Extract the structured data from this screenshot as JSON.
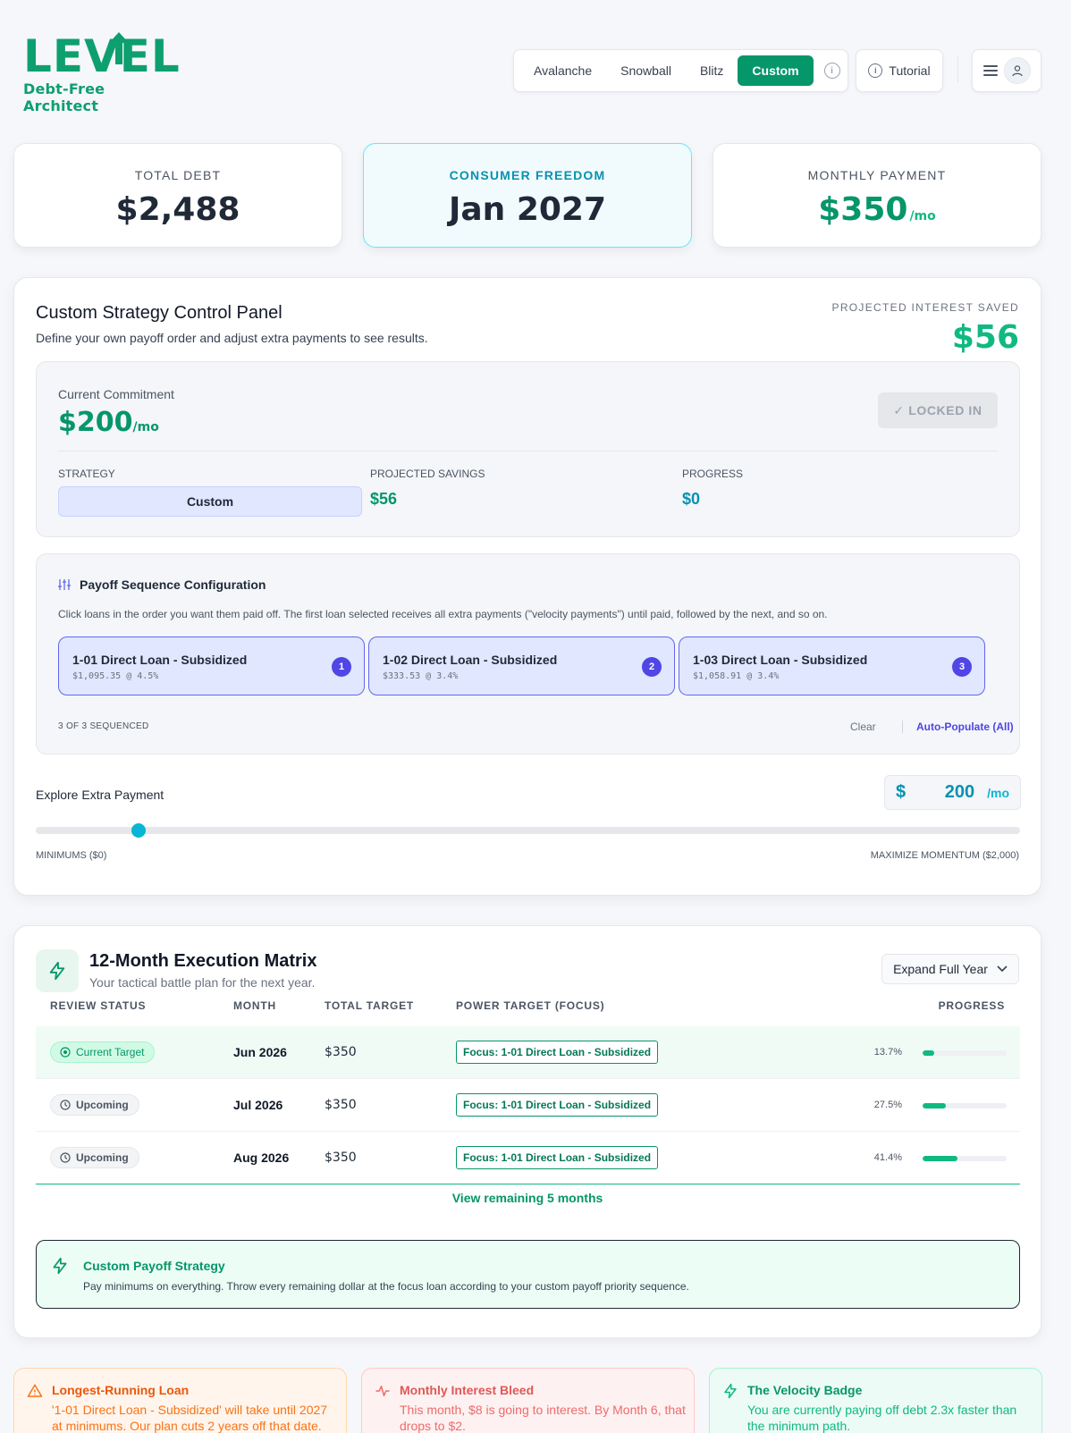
{
  "logo": {
    "word": "LEVEL",
    "tagline": "Debt-Free Architect"
  },
  "header": {
    "strategies": [
      {
        "label": "Avalanche",
        "active": false
      },
      {
        "label": "Snowball",
        "active": false
      },
      {
        "label": "Blitz",
        "active": false
      },
      {
        "label": "Custom",
        "active": true
      }
    ],
    "tutorial_label": "Tutorial"
  },
  "stats": {
    "total_debt": {
      "label": "TOTAL DEBT",
      "value": "$2,488"
    },
    "consumer_freedom": {
      "label": "CONSUMER FREEDOM",
      "value": "Jan 2027"
    },
    "monthly_payment": {
      "label": "MONTHLY PAYMENT",
      "value": "$350",
      "unit": "/mo"
    }
  },
  "panel": {
    "title": "Custom Strategy Control Panel",
    "subtitle": "Define your own payoff order and adjust extra payments to see results.",
    "interest_saved_label": "PROJECTED INTEREST SAVED",
    "interest_saved_value": "$56",
    "commitment": {
      "label": "Current Commitment",
      "value": "$200",
      "unit": "/mo",
      "locked_label": "✓ LOCKED IN",
      "strategy_label": "STRATEGY",
      "strategy_value": "Custom",
      "savings_label": "PROJECTED SAVINGS",
      "savings_value": "$56",
      "progress_label": "PROGRESS",
      "progress_value": "$0"
    },
    "sequence": {
      "title": "Payoff Sequence Configuration",
      "description": "Click loans in the order you want them paid off. The first loan selected receives all extra payments (\"velocity payments\") until paid, followed by the next, and so on.",
      "loans": [
        {
          "name": "1-01 Direct Loan - Subsidized",
          "detail": "$1,095.35 @ 4.5%",
          "order": "1"
        },
        {
          "name": "1-02 Direct Loan - Subsidized",
          "detail": "$333.53 @ 3.4%",
          "order": "2"
        },
        {
          "name": "1-03 Direct Loan - Subsidized",
          "detail": "$1,058.91 @ 3.4%",
          "order": "3"
        }
      ],
      "count_label": "3 OF 3 SEQUENCED",
      "clear_label": "Clear",
      "auto_label": "Auto-Populate (All)"
    },
    "extra_payment": {
      "label": "Explore Extra Payment",
      "currency": "$",
      "amount": "200",
      "unit": "/mo",
      "slider_value": 200,
      "slider_min": 0,
      "slider_max": 2000,
      "min_label": "MINIMUMS ($0)",
      "max_label": "MAXIMIZE MOMENTUM ($2,000)"
    }
  },
  "matrix": {
    "title": "12-Month Execution Matrix",
    "subtitle": "Your tactical battle plan for the next year.",
    "expand_label": "Expand Full Year",
    "columns": [
      "REVIEW STATUS",
      "MONTH",
      "TOTAL TARGET",
      "POWER TARGET (FOCUS)",
      "PROGRESS"
    ],
    "rows": [
      {
        "status": "Current Target",
        "month": "Jun 2026",
        "total": "$350",
        "focus": "Focus: 1-01 Direct Loan - Subsidized",
        "progress_label": "13.7%",
        "progress": 13.7
      },
      {
        "status": "Upcoming",
        "month": "Jul 2026",
        "total": "$350",
        "focus": "Focus: 1-01 Direct Loan - Subsidized",
        "progress_label": "27.5%",
        "progress": 27.5
      },
      {
        "status": "Upcoming",
        "month": "Aug 2026",
        "total": "$350",
        "focus": "Focus: 1-01 Direct Loan - Subsidized",
        "progress_label": "41.4%",
        "progress": 41.4
      }
    ],
    "view_more_label": "View remaining 5 months",
    "strategy_card": {
      "title": "Custom Payoff Strategy",
      "description": "Pay minimums on everything. Throw every remaining dollar at the focus loan according to your custom payoff priority sequence."
    }
  },
  "alerts": [
    {
      "title": "Longest-Running Loan",
      "description": "'1-01 Direct Loan - Subsidized' will take until 2027 at minimums. Our plan cuts 2 years off that date."
    },
    {
      "title": "Monthly Interest Bleed",
      "description": "This month, $8 is going to interest. By Month 6, that drops to $2."
    },
    {
      "title": "The Velocity Badge",
      "description": "You are currently paying off debt 2.3x faster than the minimum path."
    }
  ]
}
